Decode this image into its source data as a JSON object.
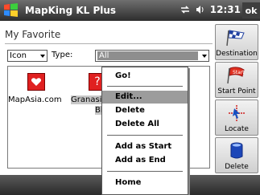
{
  "titlebar": {
    "app_title": "MapKing KL Plus",
    "time": "12:31",
    "ok_label": "ok",
    "icons": [
      "windows-flag-icon",
      "connectivity-icon",
      "volume-icon"
    ]
  },
  "main": {
    "heading": "My Favorite",
    "view_select_value": "Icon",
    "type_label": "Type:",
    "type_select_value": "All",
    "items": [
      {
        "label": "MapAsia.com",
        "icon": "heart-icon"
      },
      {
        "label": "Granasi",
        "icon": "question-icon"
      },
      {
        "label": "Bh",
        "icon": ""
      }
    ]
  },
  "sidebar": {
    "buttons": [
      {
        "label": "Destination",
        "icon": "checkered-flag-icon"
      },
      {
        "label": "Start Point",
        "icon": "start-flag-icon"
      },
      {
        "label": "Locate",
        "icon": "crosshair-icon"
      },
      {
        "label": "Delete",
        "icon": "trash-can-icon"
      }
    ]
  },
  "context_menu": {
    "items": [
      "Go!",
      "Edit...",
      "Delete",
      "Delete All",
      "Add as Start",
      "Add as End",
      "Home"
    ],
    "highlighted": "Edit..."
  },
  "colors": {
    "titlebar": "#3a3a3a",
    "highlight": "#9c9c9c",
    "favorite_red": "#e02020"
  }
}
